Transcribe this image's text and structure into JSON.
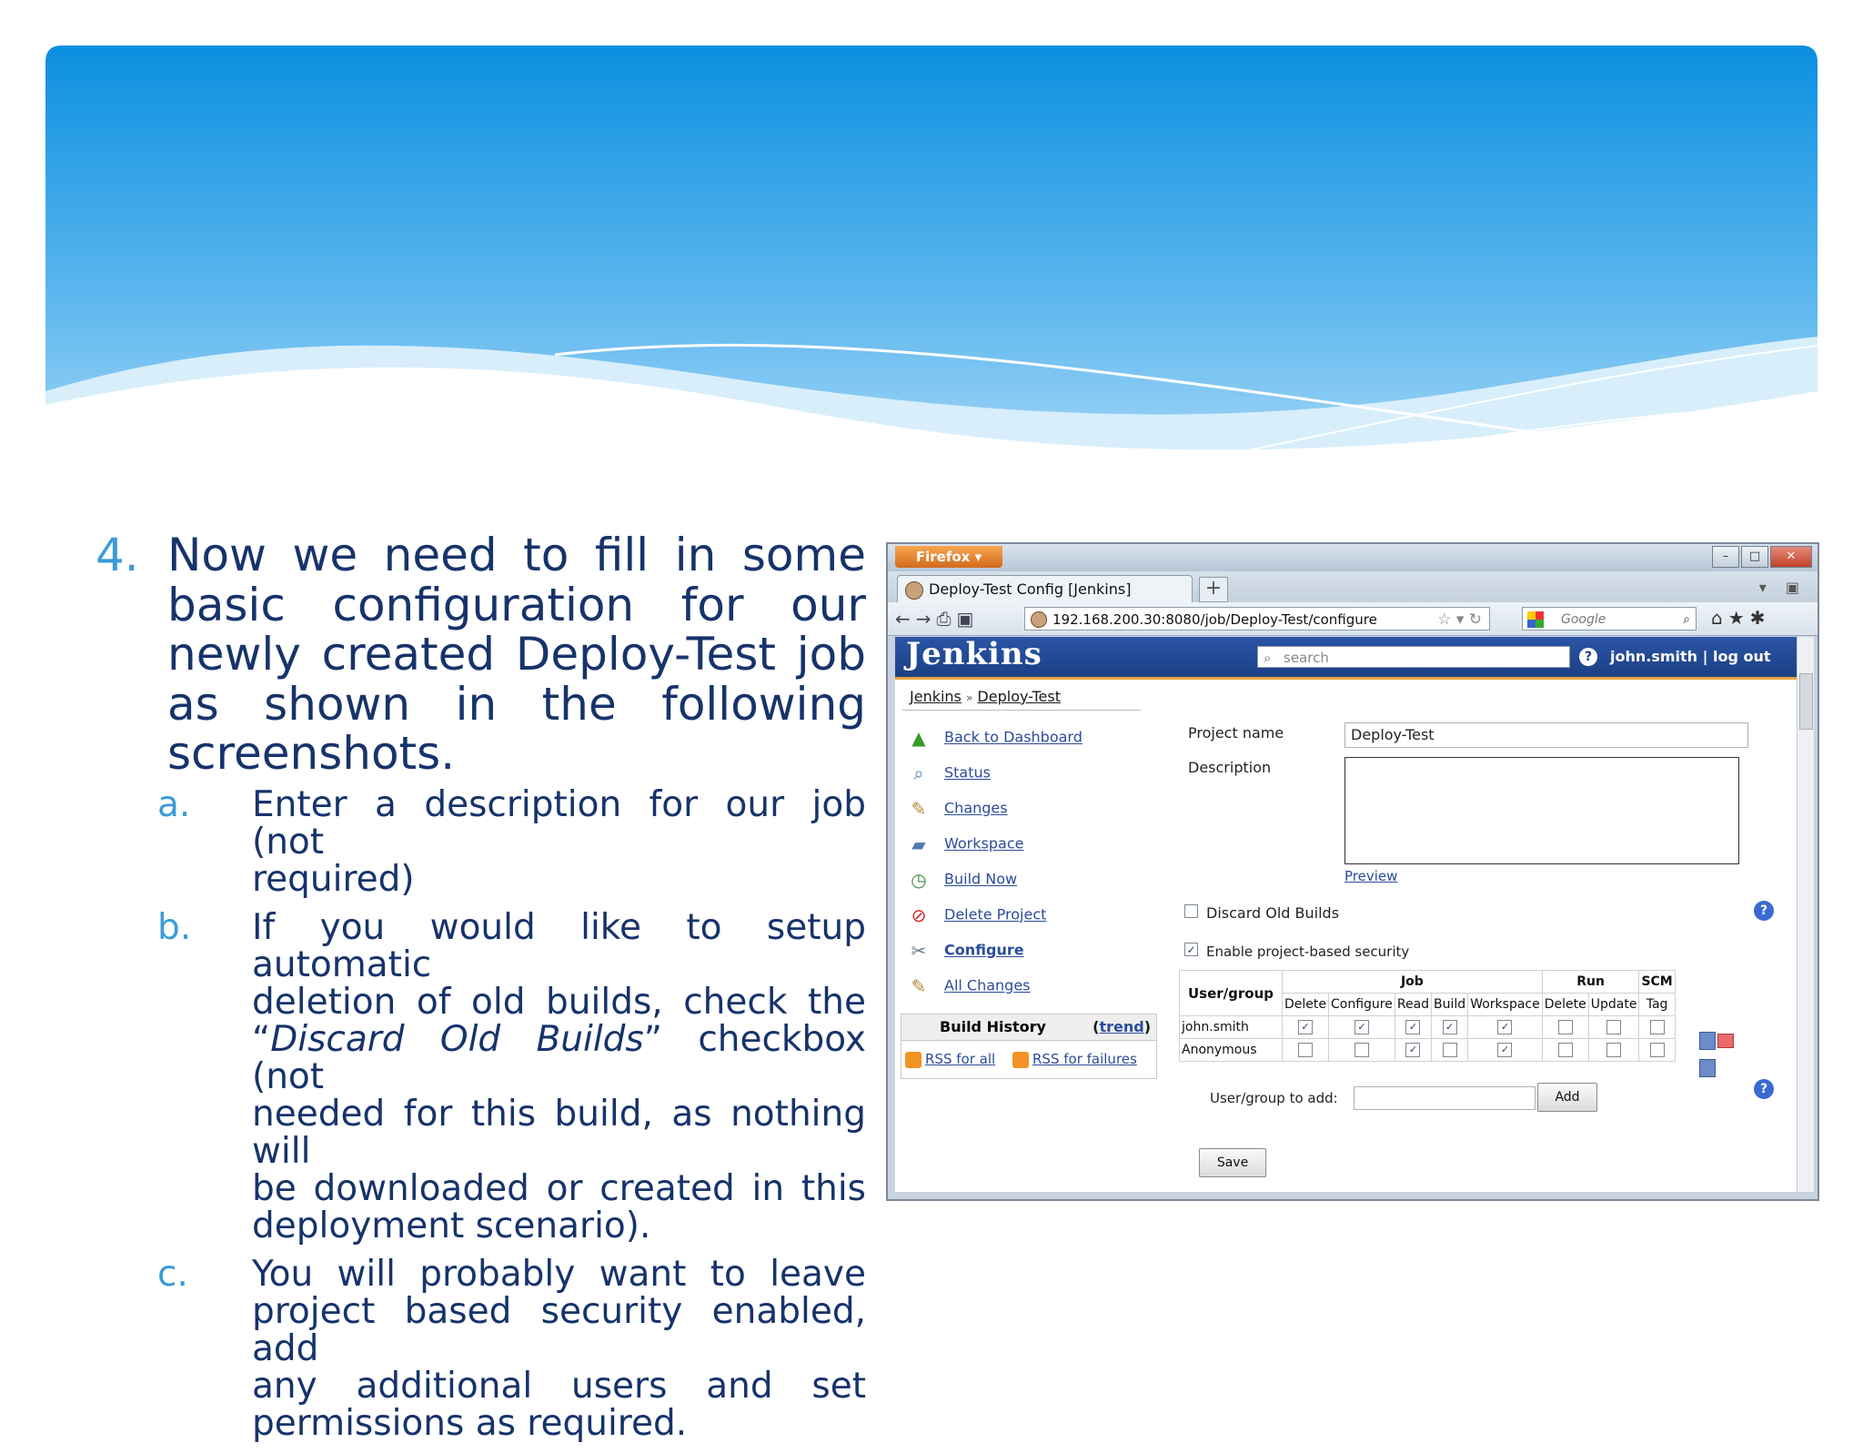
{
  "slide": {
    "main_number": "4.",
    "main_lines": [
      "Now we need to fill in some",
      "basic configuration for our",
      "newly created Deploy-Test job",
      "as shown in the following",
      "screenshots."
    ],
    "subitems": [
      {
        "letter": "a.",
        "lines": [
          "Enter a description for our job (not",
          "required)"
        ]
      },
      {
        "letter": "b.",
        "line1": "If you would like to setup automatic",
        "line2": "deletion of old builds, check the",
        "line3_pre": "“",
        "line3_em": "Discard Old Builds",
        "line3_post": "” checkbox (not",
        "line4": "needed for this build, as nothing will",
        "line5": "be downloaded or created in this",
        "line6": "deployment scenario)."
      },
      {
        "letter": "c.",
        "lines": [
          "You will probably want to leave",
          "project based security enabled, add",
          "any additional users and set",
          "permissions as required."
        ]
      }
    ]
  },
  "browser": {
    "app_button": "Firefox ▾",
    "tab_title": "Deploy-Test Config [Jenkins]",
    "new_tab": "+",
    "url": "192.168.200.30:8080/job/Deploy-Test/configure",
    "search_engine_placeholder": "Google",
    "window_buttons": {
      "minimize": "–",
      "maximize": "□",
      "close": "✕"
    }
  },
  "jenkins": {
    "logo": "Jenkins",
    "search_placeholder": "search",
    "user_link": "john.smith | log out",
    "breadcrumb": {
      "root": "Jenkins",
      "sep": "»",
      "job": "Deploy-Test"
    },
    "tasks": [
      "Back to Dashboard",
      "Status",
      "Changes",
      "Workspace",
      "Build Now",
      "Delete Project",
      "Configure",
      "All Changes"
    ],
    "task_icons": [
      "arrow-up-icon",
      "magnifier-icon",
      "notepad-icon",
      "folder-icon",
      "clock-icon",
      "no-entry-icon",
      "wrench-icon",
      "notepad-icon"
    ],
    "build_history": {
      "title": "Build History",
      "trend_open": "(",
      "trend": "trend",
      "trend_close": ")",
      "rss_all": "RSS for all",
      "rss_failures": "RSS for failures"
    },
    "form": {
      "project_name_label": "Project name",
      "project_name_value": "Deploy-Test",
      "description_label": "Description",
      "preview_link": "Preview",
      "discard_label": "Discard Old Builds",
      "discard_checked": false,
      "security_label": "Enable project-based security",
      "security_checked": true,
      "user_group_to_add_label": "User/group to add:",
      "add_button": "Add",
      "save_button": "Save"
    },
    "permissions": {
      "groups": [
        {
          "name": "Job",
          "span": 5
        },
        {
          "name": "Run",
          "span": 2
        },
        {
          "name": "SCM",
          "span": 1
        }
      ],
      "user_header": "User/group",
      "columns": [
        "Delete",
        "Configure",
        "Read",
        "Build",
        "Workspace",
        "Delete",
        "Update",
        "Tag"
      ],
      "rows": [
        {
          "user": "john.smith",
          "checks": [
            true,
            true,
            true,
            true,
            true,
            false,
            false,
            false
          ]
        },
        {
          "user": "Anonymous",
          "checks": [
            false,
            false,
            true,
            false,
            true,
            false,
            false,
            false
          ]
        }
      ]
    }
  },
  "colors": {
    "title_text": "#17336b",
    "number_accent": "#3a9bd8",
    "jenkins_header": "#1c3f85",
    "jenkins_stripe": "#e8a23b"
  }
}
